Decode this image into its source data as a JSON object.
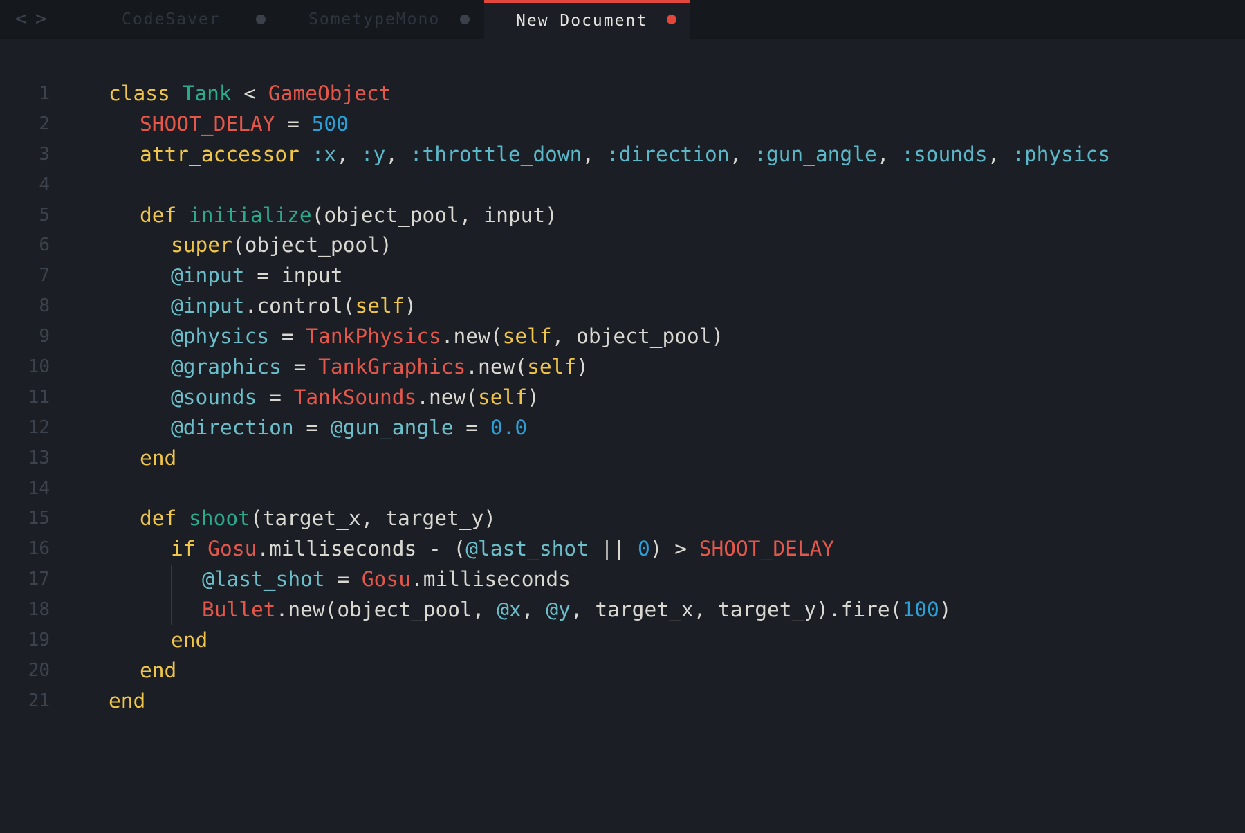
{
  "tabs": [
    {
      "label": "CodeSaver",
      "active": false,
      "modified": true
    },
    {
      "label": "SometypeMono",
      "active": false,
      "modified": true
    },
    {
      "label": "New Document",
      "active": true,
      "modified": true
    }
  ],
  "nav": {
    "back": "<",
    "forward": ">"
  },
  "colors": {
    "background": "#1b1e24",
    "keyword": "#f0c64a",
    "class": "#e4574a",
    "method_name": "#2bab8d",
    "number": "#2ca0d6",
    "symbol": "#5bb8c9",
    "active_tab_accent": "#e2473e"
  },
  "editor": {
    "line_numbers": [
      "1",
      "2",
      "3",
      "4",
      "5",
      "6",
      "7",
      "8",
      "9",
      "10",
      "11",
      "12",
      "13",
      "14",
      "15",
      "16",
      "17",
      "18",
      "19",
      "20",
      "21"
    ],
    "lines": [
      {
        "indent": 0,
        "tokens": [
          {
            "t": "kw",
            "v": "class "
          },
          {
            "t": "name",
            "v": "Tank"
          },
          {
            "t": "plain",
            "v": " < "
          },
          {
            "t": "cls",
            "v": "GameObject"
          }
        ]
      },
      {
        "indent": 1,
        "tokens": [
          {
            "t": "cls",
            "v": "SHOOT_DELAY"
          },
          {
            "t": "plain",
            "v": " = "
          },
          {
            "t": "num",
            "v": "500"
          }
        ]
      },
      {
        "indent": 1,
        "tokens": [
          {
            "t": "kw",
            "v": "attr_accessor"
          },
          {
            "t": "plain",
            "v": " "
          },
          {
            "t": "sym",
            "v": ":x"
          },
          {
            "t": "plain",
            "v": ", "
          },
          {
            "t": "sym",
            "v": ":y"
          },
          {
            "t": "plain",
            "v": ", "
          },
          {
            "t": "sym",
            "v": ":throttle_down"
          },
          {
            "t": "plain",
            "v": ", "
          },
          {
            "t": "sym",
            "v": ":direction"
          },
          {
            "t": "plain",
            "v": ", "
          },
          {
            "t": "sym",
            "v": ":gun_angle"
          },
          {
            "t": "plain",
            "v": ", "
          },
          {
            "t": "sym",
            "v": ":sounds"
          },
          {
            "t": "plain",
            "v": ", "
          },
          {
            "t": "sym",
            "v": ":physics"
          }
        ]
      },
      {
        "indent": 1,
        "tokens": []
      },
      {
        "indent": 1,
        "tokens": [
          {
            "t": "kw",
            "v": "def "
          },
          {
            "t": "name",
            "v": "initialize"
          },
          {
            "t": "plain",
            "v": "(object_pool, input)"
          }
        ]
      },
      {
        "indent": 2,
        "tokens": [
          {
            "t": "kw",
            "v": "super"
          },
          {
            "t": "plain",
            "v": "(object_pool)"
          }
        ]
      },
      {
        "indent": 2,
        "tokens": [
          {
            "t": "ivar",
            "v": "@input"
          },
          {
            "t": "plain",
            "v": " = input"
          }
        ]
      },
      {
        "indent": 2,
        "tokens": [
          {
            "t": "ivar",
            "v": "@input"
          },
          {
            "t": "plain",
            "v": ".control("
          },
          {
            "t": "kw",
            "v": "self"
          },
          {
            "t": "plain",
            "v": ")"
          }
        ]
      },
      {
        "indent": 2,
        "tokens": [
          {
            "t": "ivar",
            "v": "@physics"
          },
          {
            "t": "plain",
            "v": " = "
          },
          {
            "t": "cls",
            "v": "TankPhysics"
          },
          {
            "t": "plain",
            "v": ".new("
          },
          {
            "t": "kw",
            "v": "self"
          },
          {
            "t": "plain",
            "v": ", object_pool)"
          }
        ]
      },
      {
        "indent": 2,
        "tokens": [
          {
            "t": "ivar",
            "v": "@graphics"
          },
          {
            "t": "plain",
            "v": " = "
          },
          {
            "t": "cls",
            "v": "TankGraphics"
          },
          {
            "t": "plain",
            "v": ".new("
          },
          {
            "t": "kw",
            "v": "self"
          },
          {
            "t": "plain",
            "v": ")"
          }
        ]
      },
      {
        "indent": 2,
        "tokens": [
          {
            "t": "ivar",
            "v": "@sounds"
          },
          {
            "t": "plain",
            "v": " = "
          },
          {
            "t": "cls",
            "v": "TankSounds"
          },
          {
            "t": "plain",
            "v": ".new("
          },
          {
            "t": "kw",
            "v": "self"
          },
          {
            "t": "plain",
            "v": ")"
          }
        ]
      },
      {
        "indent": 2,
        "tokens": [
          {
            "t": "ivar",
            "v": "@direction"
          },
          {
            "t": "plain",
            "v": " = "
          },
          {
            "t": "ivar",
            "v": "@gun_angle"
          },
          {
            "t": "plain",
            "v": " = "
          },
          {
            "t": "num",
            "v": "0.0"
          }
        ]
      },
      {
        "indent": 1,
        "tokens": [
          {
            "t": "kw",
            "v": "end"
          }
        ]
      },
      {
        "indent": 1,
        "tokens": []
      },
      {
        "indent": 1,
        "tokens": [
          {
            "t": "kw",
            "v": "def "
          },
          {
            "t": "name",
            "v": "shoot"
          },
          {
            "t": "plain",
            "v": "(target_x, target_y)"
          }
        ]
      },
      {
        "indent": 2,
        "tokens": [
          {
            "t": "kw",
            "v": "if "
          },
          {
            "t": "cls",
            "v": "Gosu"
          },
          {
            "t": "plain",
            "v": ".milliseconds - ("
          },
          {
            "t": "ivar",
            "v": "@last_shot"
          },
          {
            "t": "plain",
            "v": " || "
          },
          {
            "t": "num",
            "v": "0"
          },
          {
            "t": "plain",
            "v": ") > "
          },
          {
            "t": "cls",
            "v": "SHOOT_DELAY"
          }
        ]
      },
      {
        "indent": 3,
        "tokens": [
          {
            "t": "ivar",
            "v": "@last_shot"
          },
          {
            "t": "plain",
            "v": " = "
          },
          {
            "t": "cls",
            "v": "Gosu"
          },
          {
            "t": "plain",
            "v": ".milliseconds"
          }
        ]
      },
      {
        "indent": 3,
        "tokens": [
          {
            "t": "cls",
            "v": "Bullet"
          },
          {
            "t": "plain",
            "v": ".new(object_pool, "
          },
          {
            "t": "ivar",
            "v": "@x"
          },
          {
            "t": "plain",
            "v": ", "
          },
          {
            "t": "ivar",
            "v": "@y"
          },
          {
            "t": "plain",
            "v": ", target_x, target_y).fire("
          },
          {
            "t": "num",
            "v": "100"
          },
          {
            "t": "plain",
            "v": ")"
          }
        ]
      },
      {
        "indent": 2,
        "tokens": [
          {
            "t": "kw",
            "v": "end"
          }
        ]
      },
      {
        "indent": 1,
        "tokens": [
          {
            "t": "kw",
            "v": "end"
          }
        ]
      },
      {
        "indent": 0,
        "tokens": [
          {
            "t": "kw",
            "v": "end"
          }
        ]
      }
    ]
  }
}
